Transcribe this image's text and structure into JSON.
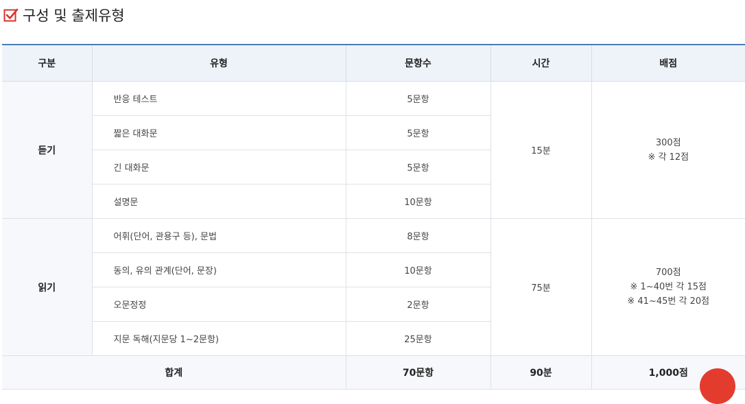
{
  "heading": {
    "title": "구성 및 출제유형",
    "icon": "checkbox-check-icon",
    "icon_color": "#d9322a"
  },
  "colors": {
    "header_border": "#4a7ab3",
    "header_bg": "#eef3f9",
    "accent_button": "#e43b2f"
  },
  "table": {
    "headers": [
      "구분",
      "유형",
      "문항수",
      "시간",
      "배점"
    ],
    "listening": {
      "section": "듣기",
      "time": "15분",
      "score_total": "300점",
      "score_note": "※ 각 12점",
      "rows": [
        {
          "type": "반응 테스트",
          "count": "5문항"
        },
        {
          "type": "짧은 대화문",
          "count": "5문항"
        },
        {
          "type": "긴 대화문",
          "count": "5문항"
        },
        {
          "type": "설명문",
          "count": "10문항"
        }
      ]
    },
    "reading": {
      "section": "읽기",
      "time": "75분",
      "score_total": "700점",
      "score_note_1": "※ 1~40번 각 15점",
      "score_note_2": "※ 41~45번 각 20점",
      "rows": [
        {
          "type": "어휘(단어, 관용구 등), 문법",
          "count": "8문항"
        },
        {
          "type": "동의, 유의 관계(단어, 문장)",
          "count": "10문항"
        },
        {
          "type": "오문정정",
          "count": "2문항"
        },
        {
          "type": "지문 독해(지문당 1~2문항)",
          "count": "25문항"
        }
      ]
    },
    "total": {
      "label": "합계",
      "count": "70문항",
      "time": "90분",
      "score": "1,000점"
    }
  }
}
